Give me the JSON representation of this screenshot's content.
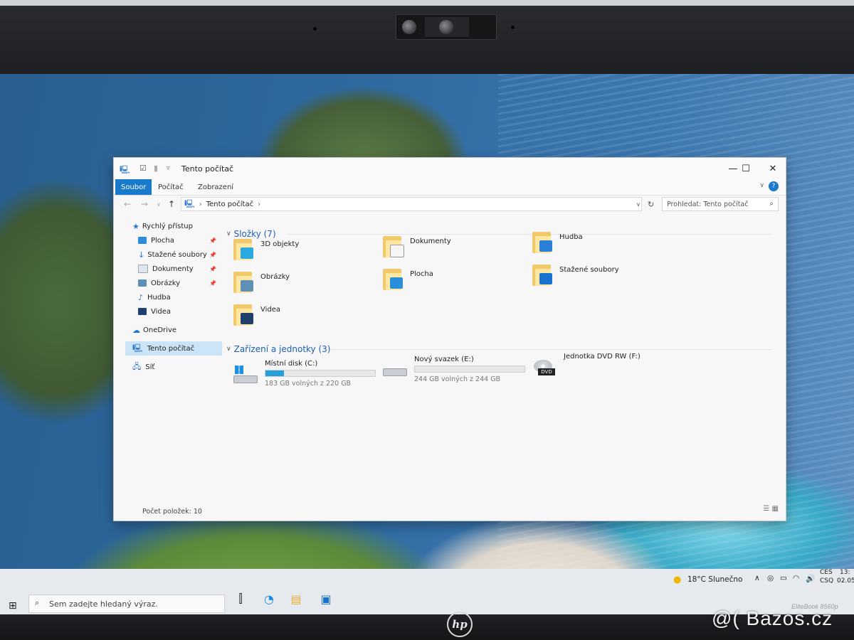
{
  "colors": {
    "accent": "#1979ca",
    "drive_fill": "#26a0da",
    "folder_yellow": "#f2c96a",
    "section_blue": "#1e5fb4"
  },
  "window": {
    "title": "Tento počítač",
    "ribbon_tabs": [
      "Soubor",
      "Počítač",
      "Zobrazení"
    ],
    "address": "Tento počítač",
    "search_placeholder": "Prohledat: Tento počítač",
    "help_label": "?"
  },
  "nav_pane": {
    "items": [
      {
        "label": "Rychlý přístup",
        "icon": "star-icon",
        "pinned": false
      },
      {
        "label": "Plocha",
        "icon": "desktop-icon",
        "pinned": true
      },
      {
        "label": "Stažené soubory",
        "icon": "download-icon",
        "pinned": true
      },
      {
        "label": "Dokumenty",
        "icon": "documents-icon",
        "pinned": true
      },
      {
        "label": "Obrázky",
        "icon": "pictures-icon",
        "pinned": true
      },
      {
        "label": "Hudba",
        "icon": "music-icon",
        "pinned": false
      },
      {
        "label": "Videa",
        "icon": "video-icon",
        "pinned": false
      },
      {
        "label": "OneDrive",
        "icon": "cloud-icon",
        "pinned": false
      },
      {
        "label": "Tento počítač",
        "icon": "computer-icon",
        "pinned": false,
        "selected": true
      },
      {
        "label": "Síť",
        "icon": "network-icon",
        "pinned": false
      }
    ]
  },
  "folders_section": {
    "title": "Složky (7)",
    "items": [
      {
        "label": "3D objekty",
        "overlay_color": "#29a9e0"
      },
      {
        "label": "Dokumenty",
        "overlay_color": "#f5f5f5"
      },
      {
        "label": "Hudba",
        "overlay_color": "#2b7fd6"
      },
      {
        "label": "Obrázky",
        "overlay_color": "#5f8fb5"
      },
      {
        "label": "Plocha",
        "overlay_color": "#2a8fd8"
      },
      {
        "label": "Stažené soubory",
        "overlay_color": "#1b73d1"
      },
      {
        "label": "Videa",
        "overlay_color": "#1f3f6e"
      }
    ]
  },
  "drives_section": {
    "title": "Zařízení a jednotky (3)",
    "items": [
      {
        "name": "Místní disk (C:)",
        "size": "183 GB volných z 220 GB",
        "used_fraction": 0.17
      },
      {
        "name": "Nový svazek (E:)",
        "size": "244 GB volných z 244 GB",
        "used_fraction": 0.0
      },
      {
        "name": "Jednotka DVD RW (F:)",
        "size": "",
        "used_fraction": null,
        "badge": "DVD"
      }
    ]
  },
  "status": {
    "item_count": "Počet položek: 10"
  },
  "taskbar": {
    "search_placeholder": "Sem zadejte hledaný výraz.",
    "weather": "18°C  Slunečno",
    "lang_top": "CES",
    "lang_bottom": "CSQ",
    "time": "13:",
    "date": "02.05"
  },
  "device": {
    "brand": "hp",
    "model": "EliteBook 8560p",
    "watermark": "@( Bazos.cz"
  }
}
